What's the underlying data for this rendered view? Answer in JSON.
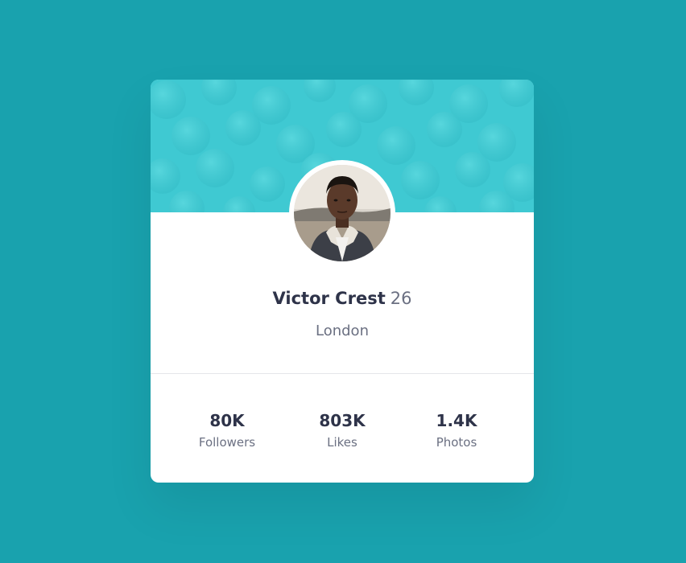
{
  "colors": {
    "page_background": "#19a2ae",
    "card_background": "#ffffff",
    "banner": "#3fc9d2",
    "text_primary": "#2e3349",
    "text_secondary": "#6b7082",
    "divider": "#e4e6ea"
  },
  "profile": {
    "name": "Victor Crest",
    "age": "26",
    "location": "London",
    "avatar_icon": "person-photo"
  },
  "stats": [
    {
      "value": "80K",
      "label": "Followers"
    },
    {
      "value": "803K",
      "label": "Likes"
    },
    {
      "value": "1.4K",
      "label": "Photos"
    }
  ]
}
